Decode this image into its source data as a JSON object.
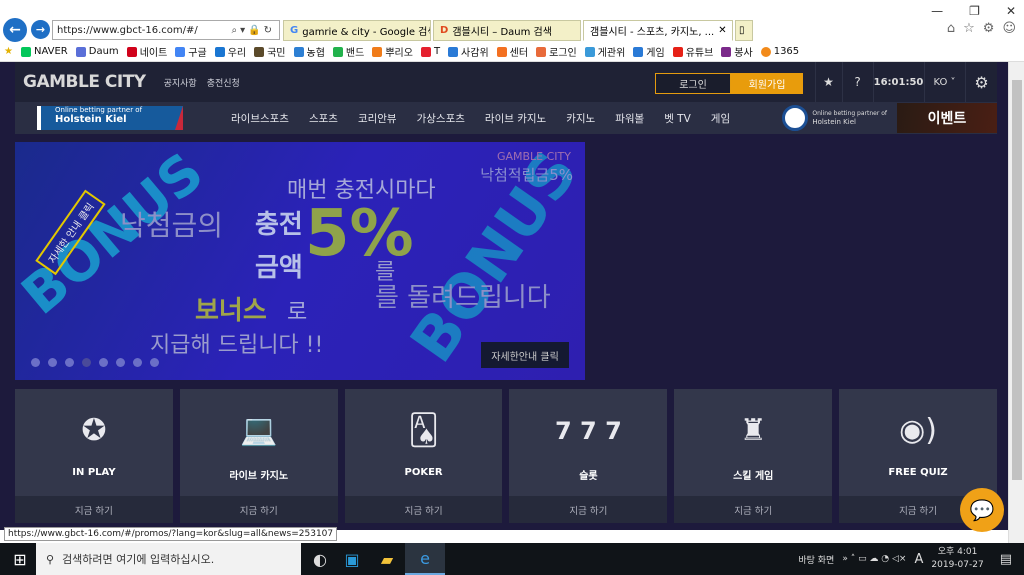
{
  "browser": {
    "url": "https://www.gbct-16.com/#/",
    "tabs": [
      {
        "label": "gamrie & city - Google 검색"
      },
      {
        "label": "갬블시티 – Daum 검색"
      },
      {
        "label": "갬블시티 - 스포츠, 카지노, ..."
      }
    ],
    "bookmarks": [
      "NAVER",
      "Daum",
      "네이트",
      "구글",
      "우리",
      "국민",
      "농협",
      "밴드",
      "뿌리오",
      "T",
      "사감위",
      "센터",
      "로그인",
      "게관위",
      "게임",
      "유튜브",
      "봉사",
      "1365"
    ],
    "status_url": "https://www.gbct-16.com/#/promos/?lang=kor&slug=all&news=253107"
  },
  "header": {
    "logo": "GAMBLE CITY",
    "links": [
      "공지사항",
      "충전신청"
    ],
    "login": "로그인",
    "signup": "회원가입",
    "time": "16:01:50",
    "lang": "KO",
    "partner_line1": "Online betting partner of",
    "partner_line2": "Holstein Kiel",
    "kiel_line1": "Online betting partner of",
    "kiel_line2": "Holstein Kiel",
    "event": "이벤트"
  },
  "nav": [
    "라이브스포츠",
    "스포츠",
    "코리안뷰",
    "가상스포츠",
    "라이브 카지노",
    "카지노",
    "파워볼",
    "벳 TV",
    "게임"
  ],
  "banner": {
    "brand": "GAMBLE CITY",
    "sub": "낙첨적립금5%",
    "line1": "매번 충전시마다",
    "line2": "낙첨금의",
    "hl1": "충전",
    "hl2": "금액",
    "pct": "5%",
    "line3": "를",
    "line4": "를 돌려드립니다",
    "hl3": "보너스",
    "line5": "로",
    "line6": "지급해 드립니다 !!",
    "tag": "자세한 안내 클릭",
    "bonus": "BONUS",
    "detail": "자세한안내 클릭",
    "slides": 8,
    "active_slide": 4
  },
  "cards": [
    {
      "label": "IN PLAY",
      "icon": "chip-icon",
      "action": "지금 하기"
    },
    {
      "label": "라이브 카지노",
      "icon": "laptop-cards-icon",
      "action": "지금 하기"
    },
    {
      "label": "POKER",
      "icon": "cards-icon",
      "action": "지금 하기"
    },
    {
      "label": "슬롯",
      "icon": "slot-777-icon",
      "action": "지금 하기"
    },
    {
      "label": "스킬 게임",
      "icon": "chess-rook-icon",
      "action": "지금 하기"
    },
    {
      "label": "FREE QUIZ",
      "icon": "quiz-icon",
      "action": "지금 하기"
    }
  ],
  "taskbar": {
    "search": "검색하려면 여기에 입력하십시오.",
    "desktop": "바탕 화면",
    "time": "오후 4:01",
    "date": "2019-07-27",
    "ime": "A"
  }
}
